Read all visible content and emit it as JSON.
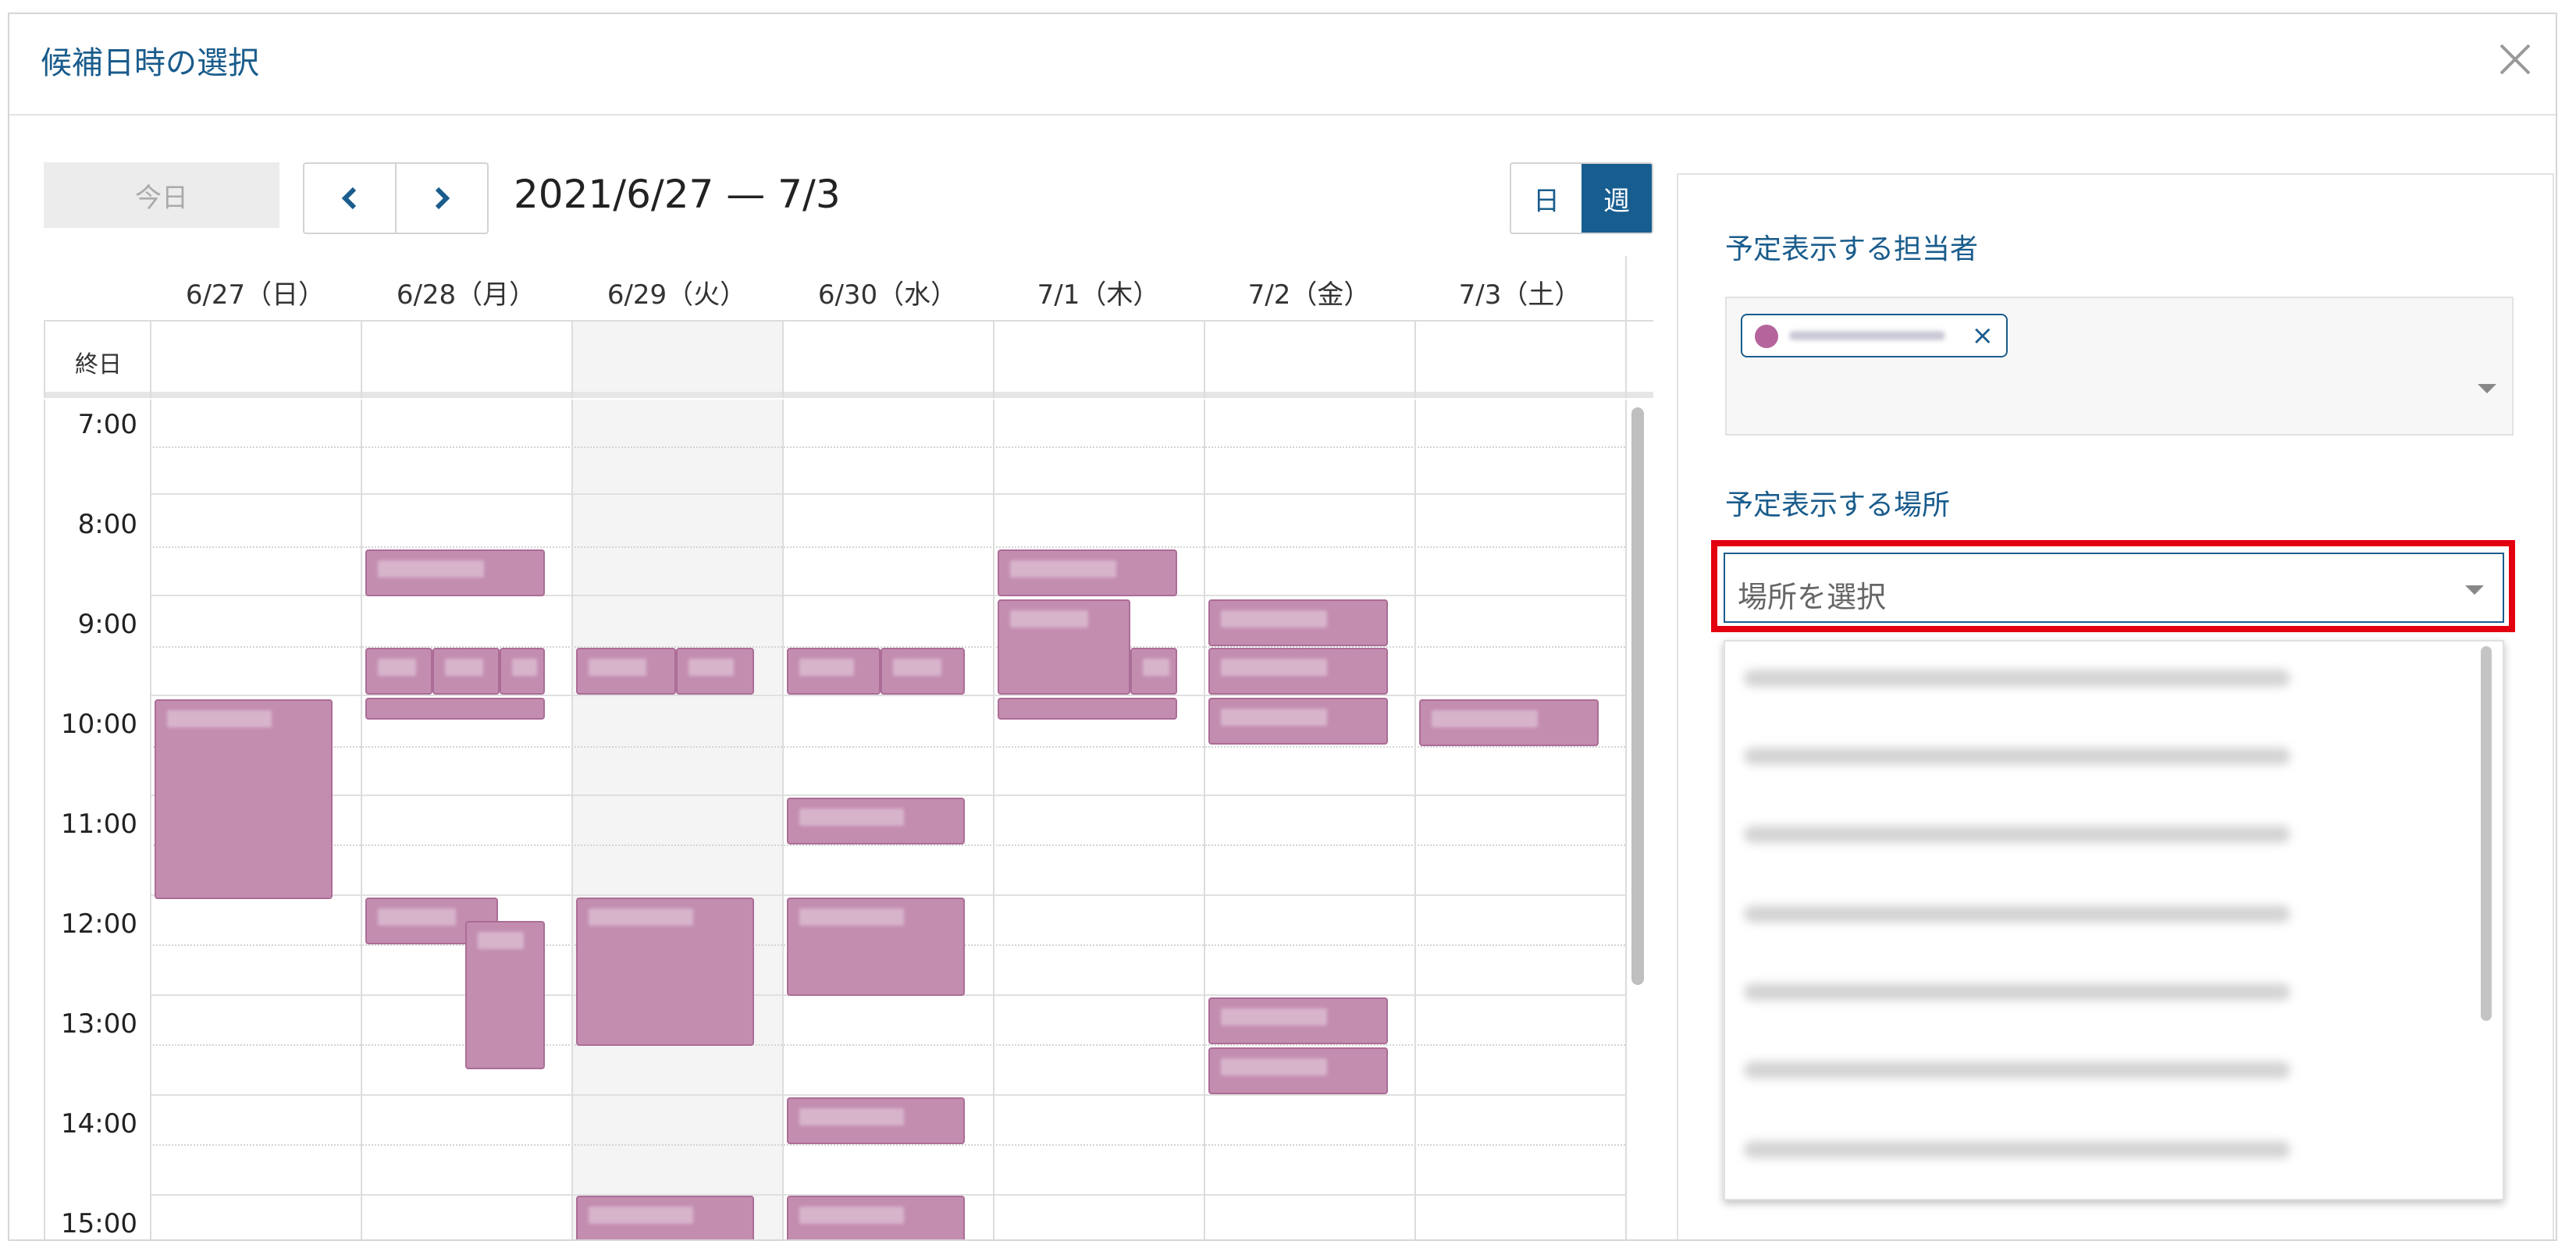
{
  "dialog": {
    "title": "候補日時の選択",
    "close_icon": "close-icon"
  },
  "toolbar": {
    "today_label": "今日",
    "prev_icon": "chevron-left-icon",
    "next_icon": "chevron-right-icon",
    "range_label": "2021/6/27 — 7/3",
    "view_day": "日",
    "view_week": "週",
    "active_view": "週"
  },
  "calendar": {
    "all_day_label": "終日",
    "days": [
      "6/27（日）",
      "6/28（月）",
      "6/29（火）",
      "6/30（水）",
      "7/1（木）",
      "7/2（金）",
      "7/3（土）"
    ],
    "times": [
      "7:00",
      "8:00",
      "9:00",
      "10:00",
      "11:00",
      "12:00",
      "13:00",
      "14:00",
      "15:00"
    ],
    "event_color": "#c38db0",
    "today_shade_color": "#f4f4f4"
  },
  "panel": {
    "assignee_label": "予定表示する担当者",
    "location_label": "予定表示する場所",
    "location_placeholder": "場所を選択",
    "highlight_color": "#e3000f",
    "assignee_chip_color": "#b5649c"
  }
}
